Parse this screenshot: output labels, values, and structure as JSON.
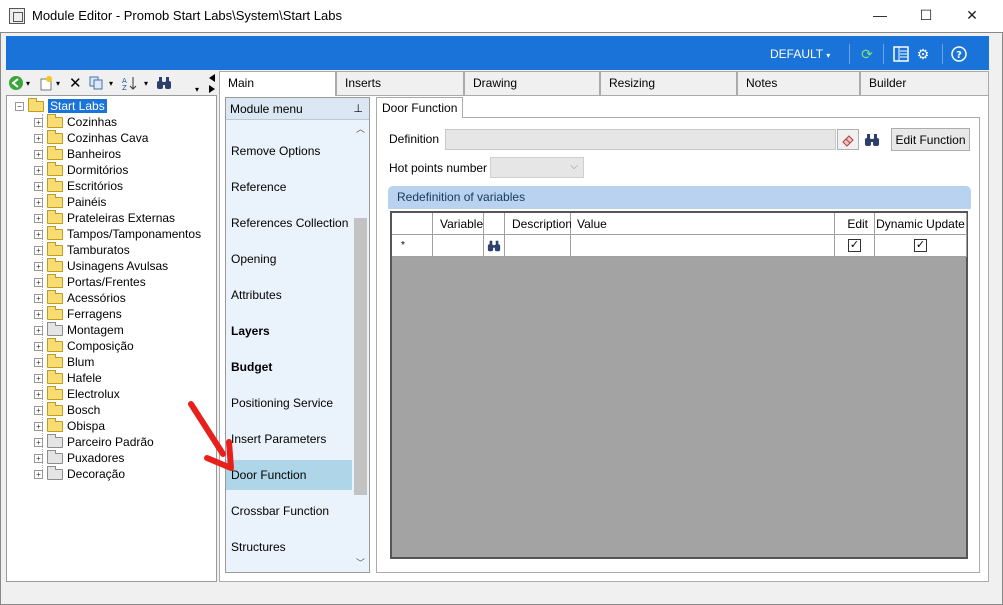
{
  "window": {
    "title": "Module Editor - Promob Start Labs\\System\\Start Labs",
    "minimize": "—",
    "maximize": "☐",
    "close": "✕"
  },
  "topbar": {
    "profile_label": "DEFAULT",
    "accent": "#1a73d8"
  },
  "tree": {
    "root": "Start Labs",
    "items": [
      {
        "label": "Cozinhas",
        "grey": false
      },
      {
        "label": "Cozinhas Cava",
        "grey": false
      },
      {
        "label": "Banheiros",
        "grey": false
      },
      {
        "label": "Dormitórios",
        "grey": false
      },
      {
        "label": "Escritórios",
        "grey": false
      },
      {
        "label": "Painéis",
        "grey": false
      },
      {
        "label": "Prateleiras Externas",
        "grey": false
      },
      {
        "label": "Tampos/Tamponamentos",
        "grey": false
      },
      {
        "label": "Tamburatos",
        "grey": false
      },
      {
        "label": "Usinagens Avulsas",
        "grey": false
      },
      {
        "label": "Portas/Frentes",
        "grey": false
      },
      {
        "label": "Acessórios",
        "grey": false
      },
      {
        "label": "Ferragens",
        "grey": false
      },
      {
        "label": "Montagem",
        "grey": true
      },
      {
        "label": "Composição",
        "grey": false
      },
      {
        "label": "Blum",
        "grey": false
      },
      {
        "label": "Hafele",
        "grey": false
      },
      {
        "label": "Electrolux",
        "grey": false
      },
      {
        "label": "Bosch",
        "grey": false
      },
      {
        "label": "Obispa",
        "grey": false
      },
      {
        "label": "Parceiro Padrão",
        "grey": true
      },
      {
        "label": "Puxadores",
        "grey": true
      },
      {
        "label": "Decoração",
        "grey": true
      }
    ]
  },
  "tabs": [
    "Main",
    "Inserts",
    "Drawing",
    "Resizing",
    "Notes",
    "Builder"
  ],
  "module_menu": {
    "header": "Module menu",
    "items": [
      {
        "label": "Remove Options",
        "bold": false
      },
      {
        "label": "Reference",
        "bold": false
      },
      {
        "label": "References Collection",
        "bold": false
      },
      {
        "label": "Opening",
        "bold": false
      },
      {
        "label": "Attributes",
        "bold": false
      },
      {
        "label": "Layers",
        "bold": true
      },
      {
        "label": "Budget",
        "bold": true
      },
      {
        "label": "Positioning Service",
        "bold": false
      },
      {
        "label": "Insert Parameters",
        "bold": false
      },
      {
        "label": "Door Function",
        "bold": false
      },
      {
        "label": "Crossbar Function",
        "bold": false
      },
      {
        "label": "Structures",
        "bold": false
      }
    ],
    "selected_index": 9
  },
  "door_function": {
    "tab_label": "Door Function",
    "definition_label": "Definition",
    "definition_value": "",
    "edit_function_label": "Edit Function",
    "hot_points_label": "Hot points number",
    "hot_points_value": "",
    "redefinition_header": "Redefinition of variables",
    "grid_columns": [
      "Variable",
      "Description",
      "Value",
      "Edit",
      "Dynamic Update"
    ],
    "new_row_marker": "*"
  }
}
